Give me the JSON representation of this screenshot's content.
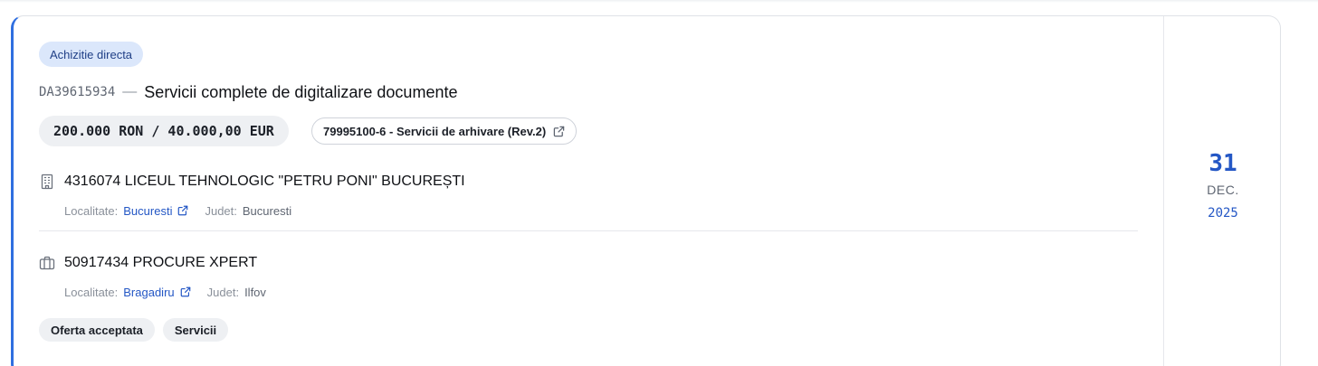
{
  "tender": {
    "type_badge": "Achizitie directa",
    "id": "DA39615934",
    "separator": "—",
    "title": "Servicii complete de digitalizare documente",
    "value": "200.000 RON / 40.000,00 EUR",
    "cpv": "79995100-6 - Servicii de arhivare (Rev.2)"
  },
  "buyer": {
    "icon": "building-icon",
    "name": "4316074 LICEUL TEHNOLOGIC \"PETRU PONI\" BUCUREȘTI",
    "locality_label": "Localitate:",
    "locality": "Bucuresti",
    "county_label": "Judet:",
    "county": "Bucuresti"
  },
  "supplier": {
    "icon": "briefcase-icon",
    "name": "50917434 PROCURE XPERT",
    "locality_label": "Localitate:",
    "locality": "Bragadiru",
    "county_label": "Judet:",
    "county": "Ilfov"
  },
  "tags": [
    "Oferta acceptata",
    "Servicii"
  ],
  "date": {
    "day": "31",
    "month": "DEC.",
    "year": "2025"
  },
  "colors": {
    "accent": "#2f6fe0",
    "link": "#2457c5",
    "badge_bg": "#dbe7fb",
    "pill_bg": "#eef0f3"
  }
}
